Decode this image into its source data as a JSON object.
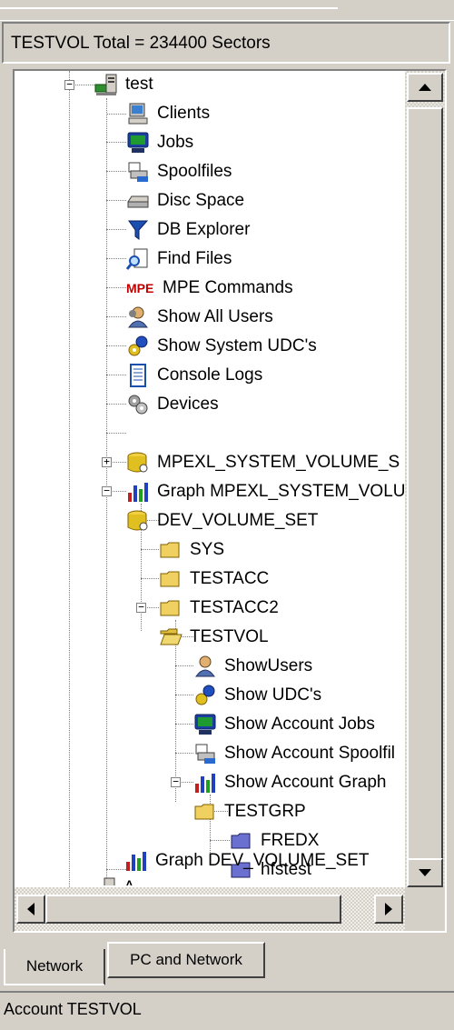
{
  "header": {
    "summary": "TESTVOL Total = 234400 Sectors"
  },
  "tree": {
    "root": "test",
    "items": {
      "clients": "Clients",
      "jobs": "Jobs",
      "spoolfiles": "Spoolfiles",
      "disc_space": "Disc Space",
      "db_explorer": "DB Explorer",
      "find_files": "Find Files",
      "mpe_commands": "MPE Commands",
      "mpe_badge": "MPE",
      "show_all_users": "Show All Users",
      "show_system_udcs": "Show System UDC's",
      "console_logs": "Console Logs",
      "devices": "Devices",
      "mpexl_volume": "MPEXL_SYSTEM_VOLUME_S",
      "graph_mpexl": "Graph MPEXL_SYSTEM_VOLU",
      "dev_volume_set": "DEV_VOLUME_SET",
      "sys": "SYS",
      "testacc": "TESTACC",
      "testacc2": "TESTACC2",
      "testvol": "TESTVOL",
      "show_users": "ShowUsers",
      "show_udcs": "Show UDC's",
      "show_account_jobs": "Show Account Jobs",
      "show_account_spoolfiles": "Show Account Spoolfil",
      "show_account_graph": "Show Account Graph",
      "testgrp": "TESTGRP",
      "fredx": "FREDX",
      "hfstest": "hfstest",
      "graph_dev_volume_set": "Graph DEV_VOLUME_SET",
      "a": "A"
    }
  },
  "tabs": {
    "network": "Network",
    "pc_and_network": "PC and Network"
  },
  "status": {
    "text": "Account TESTVOL"
  }
}
